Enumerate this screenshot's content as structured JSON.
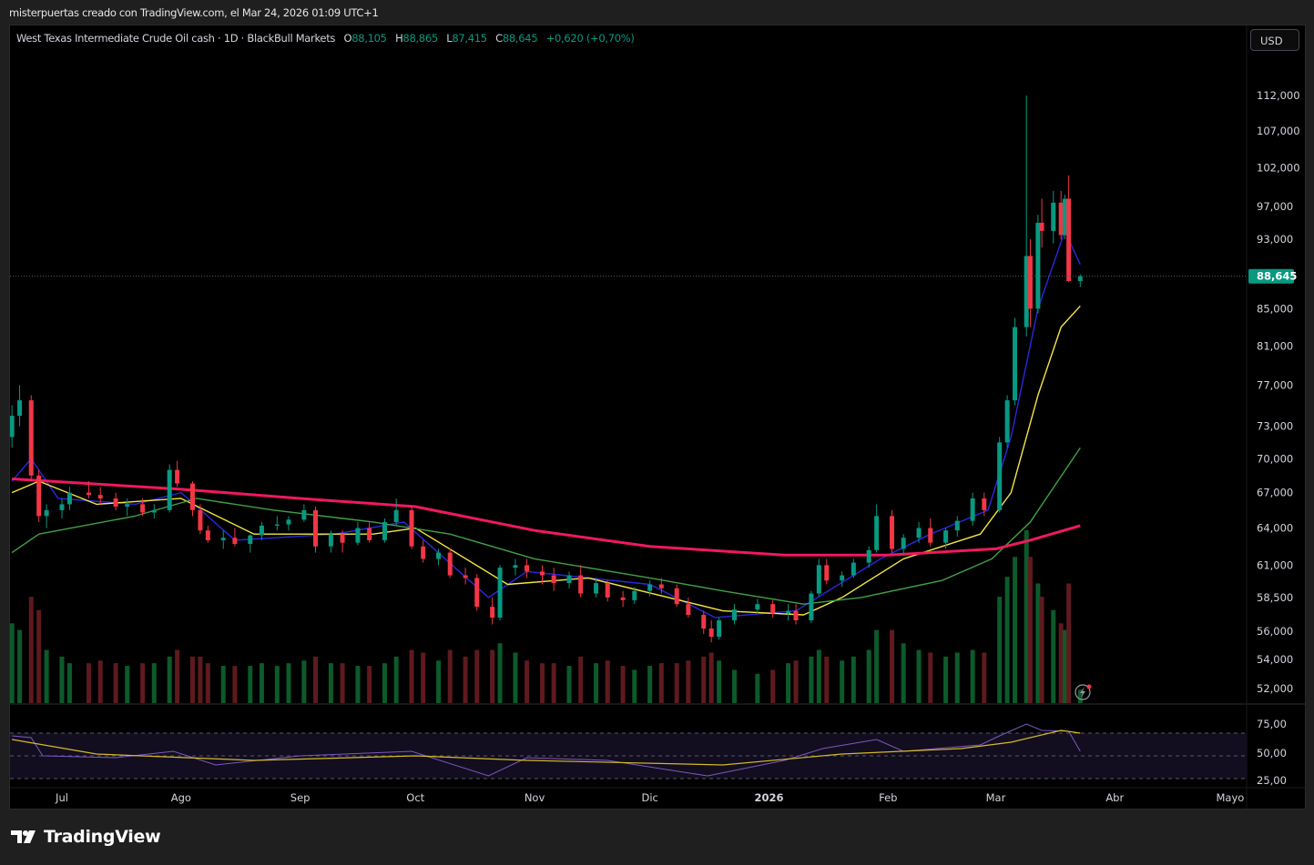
{
  "header": {
    "attribution": "misterpuertas creado con TradingView.com, el Mar 24, 2026 01:09 UTC+1"
  },
  "legend": {
    "symbol": "West Texas Intermediate Crude Oil cash · 1D · BlackBull Markets",
    "o_label": "O",
    "o": "88,105",
    "h_label": "H",
    "h": "88,865",
    "l_label": "L",
    "l": "87,415",
    "c_label": "C",
    "c": "88,645",
    "change": "+0,620 (+0,70%)"
  },
  "currency_button": "USD",
  "last_price_label": "88,645",
  "logo": {
    "text": "TradingView"
  },
  "colors": {
    "up": "#089981",
    "down": "#f23645",
    "vol_up": "#0d5a2a",
    "vol_down": "#5e1a1e",
    "ma_fast": "#2929e0",
    "ma_20": "#f5e642",
    "ma_50": "#43a047",
    "ma_200": "#f0195e",
    "rsi": "#7e57c2",
    "rsi_ma": "#d4b82a",
    "last_price": "#089981"
  },
  "chart_data": {
    "type": "candlestick",
    "title": "West Texas Intermediate Crude Oil cash · 1D · BlackBull Markets",
    "y_scale": "log",
    "ylim": [
      51000,
      116000
    ],
    "price_ticks": [
      "112,000",
      "107,000",
      "102,000",
      "97,000",
      "93,000",
      "85,000",
      "81,000",
      "77,000",
      "73,000",
      "70,000",
      "67,000",
      "64,000",
      "61,000",
      "58,500",
      "56,000",
      "54,000",
      "52,000"
    ],
    "price_tick_values": [
      112000,
      107000,
      102000,
      97000,
      93000,
      85000,
      81000,
      77000,
      73000,
      70000,
      67000,
      64000,
      61000,
      58500,
      56000,
      54000,
      52000
    ],
    "x_ticks": [
      {
        "label": "Jul",
        "date": "2025-07-01"
      },
      {
        "label": "Ago",
        "date": "2025-08-01"
      },
      {
        "label": "Sep",
        "date": "2025-09-01"
      },
      {
        "label": "Oct",
        "date": "2025-10-01"
      },
      {
        "label": "Nov",
        "date": "2025-11-01"
      },
      {
        "label": "Dic",
        "date": "2025-12-01"
      },
      {
        "label": "2026",
        "date": "2026-01-01"
      },
      {
        "label": "Feb",
        "date": "2026-02-01"
      },
      {
        "label": "Mar",
        "date": "2026-03-01"
      },
      {
        "label": "Abr",
        "date": "2026-04-01"
      },
      {
        "label": "Mayo",
        "date": "2026-05-01"
      }
    ],
    "candle_fields": [
      "date",
      "open",
      "high",
      "low",
      "close",
      "volume"
    ],
    "candles": [
      [
        "2025-06-18",
        72,
        75,
        71,
        74,
        60
      ],
      [
        "2025-06-20",
        74,
        77,
        73,
        75.5,
        55
      ],
      [
        "2025-06-23",
        75.5,
        76,
        68,
        68.5,
        80
      ],
      [
        "2025-06-25",
        68.5,
        69,
        64.5,
        65,
        70
      ],
      [
        "2025-06-27",
        65,
        66,
        64,
        65.5,
        40
      ],
      [
        "2025-07-01",
        65.5,
        66.5,
        64.8,
        66,
        35
      ],
      [
        "2025-07-03",
        66,
        67.5,
        65.5,
        67,
        30
      ],
      [
        "2025-07-08",
        67,
        68,
        66.5,
        66.8,
        30
      ],
      [
        "2025-07-11",
        66.8,
        67.5,
        66,
        66.5,
        32
      ],
      [
        "2025-07-15",
        66.5,
        67,
        65.5,
        65.8,
        30
      ],
      [
        "2025-07-18",
        65.8,
        66.5,
        65,
        66,
        28
      ],
      [
        "2025-07-22",
        66,
        66.5,
        65,
        65.3,
        30
      ],
      [
        "2025-07-25",
        65.3,
        66,
        64.8,
        65.5,
        30
      ],
      [
        "2025-07-29",
        65.5,
        69.5,
        65.3,
        69,
        35
      ],
      [
        "2025-07-31",
        69,
        69.8,
        67.5,
        67.8,
        40
      ],
      [
        "2025-08-04",
        67.8,
        68,
        65,
        65.5,
        35
      ],
      [
        "2025-08-06",
        65.5,
        66,
        63.5,
        63.8,
        35
      ],
      [
        "2025-08-08",
        63.8,
        64.2,
        62.8,
        63,
        30
      ],
      [
        "2025-08-12",
        63,
        63.8,
        62.3,
        63.2,
        28
      ],
      [
        "2025-08-15",
        63.2,
        64,
        62.5,
        62.7,
        28
      ],
      [
        "2025-08-19",
        62.7,
        63.5,
        62,
        63.4,
        28
      ],
      [
        "2025-08-22",
        63.4,
        64.5,
        63,
        64.2,
        30
      ],
      [
        "2025-08-26",
        64.2,
        65,
        63.8,
        64.3,
        28
      ],
      [
        "2025-08-29",
        64.3,
        65,
        63.8,
        64.7,
        30
      ],
      [
        "2025-09-02",
        64.7,
        66,
        64.5,
        65.5,
        32
      ],
      [
        "2025-09-05",
        65.5,
        65.8,
        62,
        62.5,
        35
      ],
      [
        "2025-09-09",
        62.5,
        63.8,
        62,
        63.5,
        30
      ],
      [
        "2025-09-12",
        63.5,
        63.8,
        62,
        62.8,
        30
      ],
      [
        "2025-09-16",
        62.8,
        64.5,
        62.6,
        64,
        28
      ],
      [
        "2025-09-19",
        64,
        64.5,
        62.8,
        63,
        28
      ],
      [
        "2025-09-23",
        63,
        64.8,
        62.8,
        64.5,
        30
      ],
      [
        "2025-09-26",
        64.5,
        66.5,
        64.2,
        65.5,
        35
      ],
      [
        "2025-09-30",
        65.5,
        65.8,
        62.3,
        62.5,
        40
      ],
      [
        "2025-10-03",
        62.5,
        63,
        61.2,
        61.5,
        38
      ],
      [
        "2025-10-07",
        61.5,
        62.3,
        61,
        62,
        32
      ],
      [
        "2025-10-10",
        62,
        62.3,
        60,
        60.2,
        40
      ],
      [
        "2025-10-14",
        60.2,
        60.8,
        59.5,
        60,
        35
      ],
      [
        "2025-10-17",
        60,
        60.3,
        57.5,
        57.8,
        40
      ],
      [
        "2025-10-21",
        57.8,
        58.5,
        56.5,
        57,
        40
      ],
      [
        "2025-10-23",
        57,
        61,
        56.8,
        60.8,
        45
      ],
      [
        "2025-10-27",
        60.8,
        61.5,
        60.2,
        61,
        38
      ],
      [
        "2025-10-30",
        61,
        61.5,
        60,
        60.5,
        32
      ],
      [
        "2025-11-03",
        60.5,
        61,
        59.5,
        60.2,
        30
      ],
      [
        "2025-11-06",
        60.2,
        60.8,
        59,
        59.6,
        30
      ],
      [
        "2025-11-10",
        59.6,
        60.5,
        59.2,
        60.2,
        28
      ],
      [
        "2025-11-13",
        60.2,
        61,
        58.5,
        58.8,
        35
      ],
      [
        "2025-11-17",
        58.8,
        60,
        58.5,
        59.6,
        30
      ],
      [
        "2025-11-20",
        59.6,
        59.8,
        58.2,
        58.5,
        32
      ],
      [
        "2025-11-24",
        58.5,
        59,
        57.8,
        58.3,
        28
      ],
      [
        "2025-11-27",
        58.3,
        59.3,
        58,
        59,
        25
      ],
      [
        "2025-12-01",
        59,
        59.8,
        58.6,
        59.5,
        28
      ],
      [
        "2025-12-04",
        59.5,
        60,
        58.8,
        59.2,
        30
      ],
      [
        "2025-12-08",
        59.2,
        59.5,
        57.8,
        58,
        30
      ],
      [
        "2025-12-11",
        58,
        58.5,
        57,
        57.2,
        32
      ],
      [
        "2025-12-15",
        57.2,
        57.5,
        55.8,
        56.2,
        35
      ],
      [
        "2025-12-17",
        56.2,
        56.8,
        55.2,
        55.6,
        38
      ],
      [
        "2025-12-19",
        55.6,
        57,
        55.4,
        56.8,
        32
      ],
      [
        "2025-12-23",
        56.8,
        58,
        56.5,
        57.6,
        25
      ],
      [
        "2025-12-29",
        57.6,
        58.4,
        57.3,
        58,
        22
      ],
      [
        "2026-01-02",
        58,
        58.3,
        57,
        57.3,
        25
      ],
      [
        "2026-01-06",
        57.3,
        58,
        56.8,
        57.5,
        30
      ],
      [
        "2026-01-08",
        57.5,
        58,
        56.5,
        56.8,
        32
      ],
      [
        "2026-01-12",
        56.8,
        59,
        56.6,
        58.8,
        35
      ],
      [
        "2026-01-14",
        58.8,
        61.5,
        58.6,
        61,
        40
      ],
      [
        "2026-01-16",
        61,
        61.5,
        59.5,
        59.8,
        35
      ],
      [
        "2026-01-20",
        59.8,
        60.5,
        59.3,
        60.2,
        32
      ],
      [
        "2026-01-23",
        60.2,
        61.5,
        60,
        61.2,
        35
      ],
      [
        "2026-01-27",
        61.2,
        62.5,
        60.8,
        62.2,
        40
      ],
      [
        "2026-01-29",
        62.2,
        66,
        62,
        65,
        55
      ],
      [
        "2026-02-02",
        65,
        65.5,
        62,
        62.3,
        55
      ],
      [
        "2026-02-05",
        62.3,
        63.5,
        61.8,
        63.2,
        45
      ],
      [
        "2026-02-09",
        63.2,
        64.5,
        62.8,
        64,
        40
      ],
      [
        "2026-02-12",
        64,
        64.8,
        62.5,
        62.8,
        38
      ],
      [
        "2026-02-16",
        62.8,
        64,
        62.3,
        63.8,
        35
      ],
      [
        "2026-02-19",
        63.8,
        65,
        63.3,
        64.6,
        38
      ],
      [
        "2026-02-23",
        64.6,
        67,
        64.2,
        66.5,
        40
      ],
      [
        "2026-02-26",
        66.5,
        67,
        65,
        65.5,
        38
      ],
      [
        "2026-03-02",
        65.5,
        72,
        65.3,
        71.5,
        80
      ],
      [
        "2026-03-04",
        71.5,
        76,
        71,
        75.5,
        95
      ],
      [
        "2026-03-06",
        75.5,
        84,
        75,
        83,
        110
      ],
      [
        "2026-03-09",
        83,
        112,
        82,
        91,
        130
      ],
      [
        "2026-03-10",
        91,
        93,
        83,
        85,
        110
      ],
      [
        "2026-03-12",
        85,
        96,
        84.5,
        95,
        90
      ],
      [
        "2026-03-13",
        95,
        98,
        92,
        94,
        80
      ],
      [
        "2026-03-16",
        94,
        99,
        92.5,
        97.5,
        70
      ],
      [
        "2026-03-18",
        97.5,
        99,
        93,
        93.5,
        60
      ],
      [
        "2026-03-19",
        93.5,
        98.5,
        93,
        98,
        55
      ],
      [
        "2026-03-20",
        98,
        101,
        88,
        88.1,
        90
      ],
      [
        "2026-03-23",
        88.1,
        88.865,
        87.415,
        88.645,
        10
      ]
    ],
    "moving_averages": [
      {
        "name": "MA fast",
        "color_key": "ma_fast",
        "points": [
          [
            "2025-06-18",
            68
          ],
          [
            "2025-06-23",
            70
          ],
          [
            "2025-06-30",
            66.5
          ],
          [
            "2025-07-20",
            66
          ],
          [
            "2025-08-01",
            67
          ],
          [
            "2025-08-15",
            63
          ],
          [
            "2025-09-10",
            63.5
          ],
          [
            "2025-09-28",
            64.5
          ],
          [
            "2025-10-20",
            58.5
          ],
          [
            "2025-10-30",
            60.5
          ],
          [
            "2025-12-01",
            59.5
          ],
          [
            "2025-12-18",
            57
          ],
          [
            "2026-01-08",
            57.5
          ],
          [
            "2026-01-30",
            61.5
          ],
          [
            "2026-02-12",
            63.5
          ],
          [
            "2026-02-27",
            65.5
          ],
          [
            "2026-03-05",
            72
          ],
          [
            "2026-03-12",
            85
          ],
          [
            "2026-03-19",
            94
          ],
          [
            "2026-03-23",
            90
          ]
        ]
      },
      {
        "name": "MA 20",
        "color_key": "ma_20",
        "points": [
          [
            "2025-06-18",
            67
          ],
          [
            "2025-06-25",
            68
          ],
          [
            "2025-07-10",
            66
          ],
          [
            "2025-08-01",
            66.5
          ],
          [
            "2025-08-20",
            63.5
          ],
          [
            "2025-09-20",
            63.5
          ],
          [
            "2025-10-01",
            64
          ],
          [
            "2025-10-25",
            59.5
          ],
          [
            "2025-11-15",
            60
          ],
          [
            "2025-12-20",
            57.5
          ],
          [
            "2026-01-10",
            57.2
          ],
          [
            "2026-01-20",
            58.5
          ],
          [
            "2026-02-05",
            61.5
          ],
          [
            "2026-02-25",
            63.5
          ],
          [
            "2026-03-05",
            67
          ],
          [
            "2026-03-12",
            76
          ],
          [
            "2026-03-18",
            83
          ],
          [
            "2026-03-23",
            85.3
          ]
        ]
      },
      {
        "name": "MA 50",
        "color_key": "ma_50",
        "points": [
          [
            "2025-06-18",
            62
          ],
          [
            "2025-06-25",
            63.5
          ],
          [
            "2025-07-20",
            65
          ],
          [
            "2025-08-05",
            66.5
          ],
          [
            "2025-08-25",
            65.5
          ],
          [
            "2025-09-20",
            64.5
          ],
          [
            "2025-10-10",
            63.5
          ],
          [
            "2025-11-01",
            61.5
          ],
          [
            "2025-12-01",
            60
          ],
          [
            "2025-12-20",
            59
          ],
          [
            "2026-01-10",
            58
          ],
          [
            "2026-01-25",
            58.5
          ],
          [
            "2026-02-15",
            59.8
          ],
          [
            "2026-02-28",
            61.5
          ],
          [
            "2026-03-10",
            64.5
          ],
          [
            "2026-03-23",
            71
          ]
        ]
      },
      {
        "name": "MA 200",
        "color_key": "ma_200",
        "points": [
          [
            "2025-06-18",
            68.2
          ],
          [
            "2025-08-01",
            67.3
          ],
          [
            "2025-09-01",
            66.5
          ],
          [
            "2025-10-01",
            65.8
          ],
          [
            "2025-11-01",
            63.8
          ],
          [
            "2025-12-01",
            62.5
          ],
          [
            "2026-01-05",
            61.8
          ],
          [
            "2026-02-01",
            61.8
          ],
          [
            "2026-03-01",
            62.3
          ],
          [
            "2026-03-10",
            63
          ],
          [
            "2026-03-23",
            64.2
          ]
        ]
      }
    ],
    "rsi": {
      "ticks": [
        "75,00",
        "50,00",
        "25,00"
      ],
      "tick_values": [
        75,
        50,
        25
      ],
      "ylim": [
        20,
        90
      ],
      "values": [
        [
          "2025-06-18",
          72
        ],
        [
          "2025-06-23",
          70
        ],
        [
          "2025-06-26",
          50
        ],
        [
          "2025-07-15",
          48
        ],
        [
          "2025-07-30",
          55
        ],
        [
          "2025-08-10",
          40
        ],
        [
          "2025-09-01",
          50
        ],
        [
          "2025-09-30",
          55
        ],
        [
          "2025-10-20",
          28
        ],
        [
          "2025-10-30",
          48
        ],
        [
          "2025-11-20",
          45
        ],
        [
          "2025-12-16",
          28
        ],
        [
          "2026-01-05",
          45
        ],
        [
          "2026-01-15",
          58
        ],
        [
          "2026-01-29",
          68
        ],
        [
          "2026-02-05",
          55
        ],
        [
          "2026-02-25",
          62
        ],
        [
          "2026-03-02",
          72
        ],
        [
          "2026-03-09",
          85
        ],
        [
          "2026-03-13",
          78
        ],
        [
          "2026-03-20",
          77
        ],
        [
          "2026-03-23",
          55
        ]
      ],
      "ma": [
        [
          "2025-06-18",
          68
        ],
        [
          "2025-07-10",
          52
        ],
        [
          "2025-08-20",
          45
        ],
        [
          "2025-10-01",
          50
        ],
        [
          "2025-10-30",
          45
        ],
        [
          "2025-12-20",
          40
        ],
        [
          "2026-01-20",
          52
        ],
        [
          "2026-02-20",
          58
        ],
        [
          "2026-03-05",
          65
        ],
        [
          "2026-03-18",
          78
        ],
        [
          "2026-03-23",
          75
        ]
      ]
    }
  }
}
